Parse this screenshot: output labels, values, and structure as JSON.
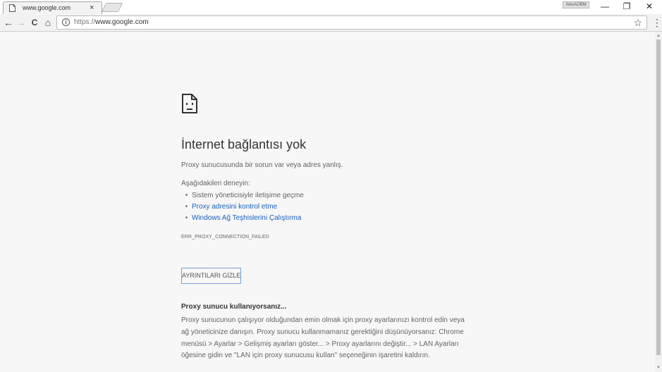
{
  "window": {
    "profile_name": "AlexAOBM",
    "minimize_glyph": "—",
    "restore_glyph": "❐",
    "close_glyph": "✕"
  },
  "tab": {
    "title": "www.google.com",
    "close_glyph": "×",
    "favicon": "page-icon"
  },
  "toolbar": {
    "back_glyph": "←",
    "forward_glyph": "→",
    "reload_glyph": "C",
    "home_glyph": "⌂",
    "info_glyph": "i",
    "url_scheme": "https://",
    "url_host": "www.google.com",
    "star_glyph": "☆",
    "menu_glyph": "⋮"
  },
  "scrollbar": {
    "up_glyph": "▲",
    "down_glyph": "▼"
  },
  "error_page": {
    "icon": "sad-page-icon",
    "heading": "İnternet bağlantısı yok",
    "summary": "Proxy sunucusunda bir sorun var veya adres yanlış.",
    "try_label": "Aşağıdakileri deneyin:",
    "suggestions": [
      "Sistem yöneticisiyle iletişime geçme",
      "Proxy adresini kontrol etme",
      "Windows Ağ Teşhislerini Çalıştırma"
    ],
    "bullet": "•",
    "error_code": "ERR_PROXY_CONNECTION_FAILED",
    "details_button": "AYRINTILARI GİZLE",
    "proxy_title": "Proxy sunucu kullanıyorsanız...",
    "proxy_lines": [
      "Proxy sunucunun çalışıyor olduğundan emin olmak için proxy ayarlarınızı kontrol edin veya",
      "ağ yöneticinize danışın. Proxy sunucu kullanmamanız gerektiğini düşünüyorsanız: Chrome",
      "menüsü > Ayarlar > Gelişmiş ayarları göster... > Proxy ayarlarını değiştir... > LAN Ayarları",
      "öğesine gidin ve \"LAN için proxy sunucusu kullan\" seçeneğinin işaretini kaldırın."
    ]
  },
  "colors": {
    "link": "#1a5fbf",
    "page_background": "#f7f7f7",
    "button_border": "#7a9fd8"
  }
}
